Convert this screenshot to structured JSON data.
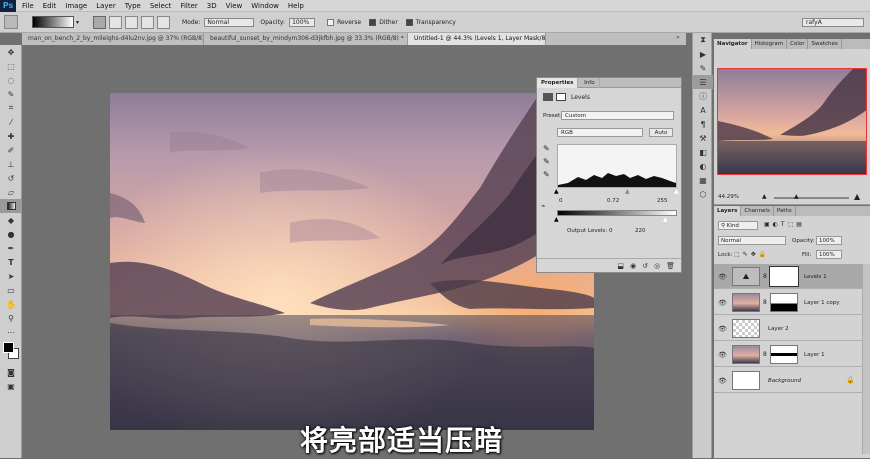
{
  "app": {
    "logo": "Ps"
  },
  "menu": [
    "File",
    "Edit",
    "Image",
    "Layer",
    "Type",
    "Select",
    "Filter",
    "3D",
    "View",
    "Window",
    "Help"
  ],
  "options": {
    "mode_label": "Mode:",
    "mode_value": "Normal",
    "opacity_label": "Opacity:",
    "opacity_value": "100%",
    "reverse": "Reverse",
    "dither": "Dither",
    "transparency": "Transparency",
    "workspace": "rafyA"
  },
  "tabs": [
    {
      "label": "man_on_bench_2_by_mileighs-d4lu2nv.jpg @ 37% (RGB/8) *"
    },
    {
      "label": "beautiful_sunset_by_mindym306-d3jkfbh.jpg @ 33.3% (RGB/8) *"
    },
    {
      "label": "Untitled-1 @ 44.3% (Levels 1, Layer Mask/8) *"
    }
  ],
  "subtitle": "将亮部适当压暗",
  "properties": {
    "tabs": [
      "Properties",
      "Info"
    ],
    "title": "Levels",
    "preset_label": "Preset:",
    "preset_value": "Custom",
    "channel": "RGB",
    "auto": "Auto",
    "input_values": [
      "0",
      "0.72",
      "255"
    ],
    "output_label": "Output Levels:",
    "output_values": [
      "0",
      "220"
    ]
  },
  "navigator": {
    "tabs": [
      "Navigator",
      "Histogram",
      "Color",
      "Swatches"
    ],
    "zoom": "44.29%"
  },
  "layers": {
    "tabs": [
      "Layers",
      "Channels",
      "Paths"
    ],
    "filter": "Kind",
    "blend": "Normal",
    "opacity_label": "Opacity:",
    "opacity_value": "100%",
    "lock_label": "Lock:",
    "fill_label": "Fill:",
    "fill_value": "100%",
    "items": [
      {
        "name": "Levels 1"
      },
      {
        "name": "Layer 1 copy"
      },
      {
        "name": "Layer 2"
      },
      {
        "name": "Layer 1"
      },
      {
        "name": "Background"
      }
    ]
  }
}
